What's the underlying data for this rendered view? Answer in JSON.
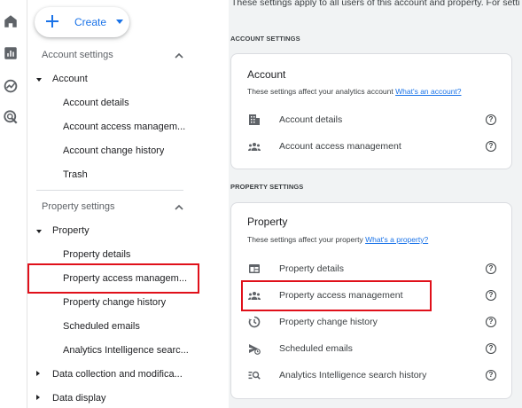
{
  "rail": {
    "icons": [
      "home-icon",
      "reports-icon",
      "explore-icon",
      "advertising-icon"
    ]
  },
  "sidebar": {
    "create_label": "Create",
    "account_section": {
      "title": "Account settings",
      "group": "Account",
      "items": [
        "Account details",
        "Account access managem...",
        "Account change history",
        "Trash"
      ]
    },
    "property_section": {
      "title": "Property settings",
      "group": "Property",
      "items": [
        "Property details",
        "Property access managem...",
        "Property change history",
        "Scheduled emails",
        "Analytics Intelligence searc..."
      ]
    },
    "collapsed_groups": [
      "Data collection and modifica...",
      "Data display"
    ]
  },
  "main": {
    "top_note": "These settings apply to all users of this account and property. For setti",
    "account_label": "ACCOUNT SETTINGS",
    "account_card": {
      "title": "Account",
      "subtitle": "These settings affect your analytics account",
      "link": "What's an account?",
      "rows": [
        "Account details",
        "Account access management"
      ]
    },
    "property_label": "PROPERTY SETTINGS",
    "property_card": {
      "title": "Property",
      "subtitle": "These settings affect your property",
      "link": "What's a property?",
      "rows": [
        "Property details",
        "Property access management",
        "Property change history",
        "Scheduled emails",
        "Analytics Intelligence search history"
      ]
    },
    "help_glyph": "?"
  },
  "colors": {
    "accent": "#1a73e8",
    "highlight": "#e0101a",
    "main_bg": "#f1f3f4"
  }
}
